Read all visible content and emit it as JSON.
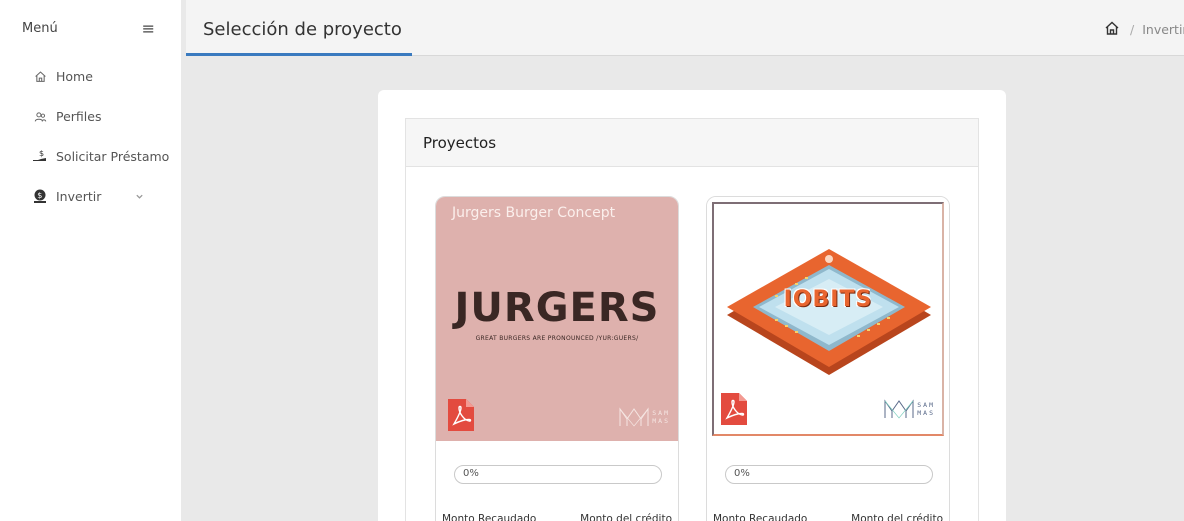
{
  "sidebar": {
    "title": "Menú",
    "menu_icon": "hamburger-icon",
    "items": [
      {
        "label": "Home",
        "icon": "home-icon"
      },
      {
        "label": "Perfiles",
        "icon": "users-icon"
      },
      {
        "label": "Solicitar Préstamo",
        "icon": "hand-money-icon"
      },
      {
        "label": "Invertir",
        "icon": "coin-icon",
        "has_submenu": true
      }
    ]
  },
  "header": {
    "title": "Selección de proyecto",
    "breadcrumb": [
      "Invertir"
    ]
  },
  "main": {
    "section_title": "Proyectos",
    "projects": [
      {
        "title": "Jurgers Burger Concept",
        "logo_text": "JURGERS",
        "tagline": "GREAT BURGERS ARE PRONOUNCED /YUR:GUERS/",
        "brand": "SAM MAS",
        "progress": 0,
        "progress_label": "0%",
        "raised_label": "Monto Recaudado",
        "credit_label": "Monto del crédito"
      },
      {
        "title": "",
        "logo_text": "IOBITS",
        "brand": "SAM MAS",
        "progress": 0,
        "progress_label": "0%",
        "raised_label": "Monto Recaudado",
        "credit_label": "Monto del crédito"
      }
    ]
  },
  "colors": {
    "accent": "#3a7abf",
    "jurgers_bg": "#deb1ad",
    "pdf_red": "#e34b3f",
    "chip_orange": "#e8652f"
  }
}
